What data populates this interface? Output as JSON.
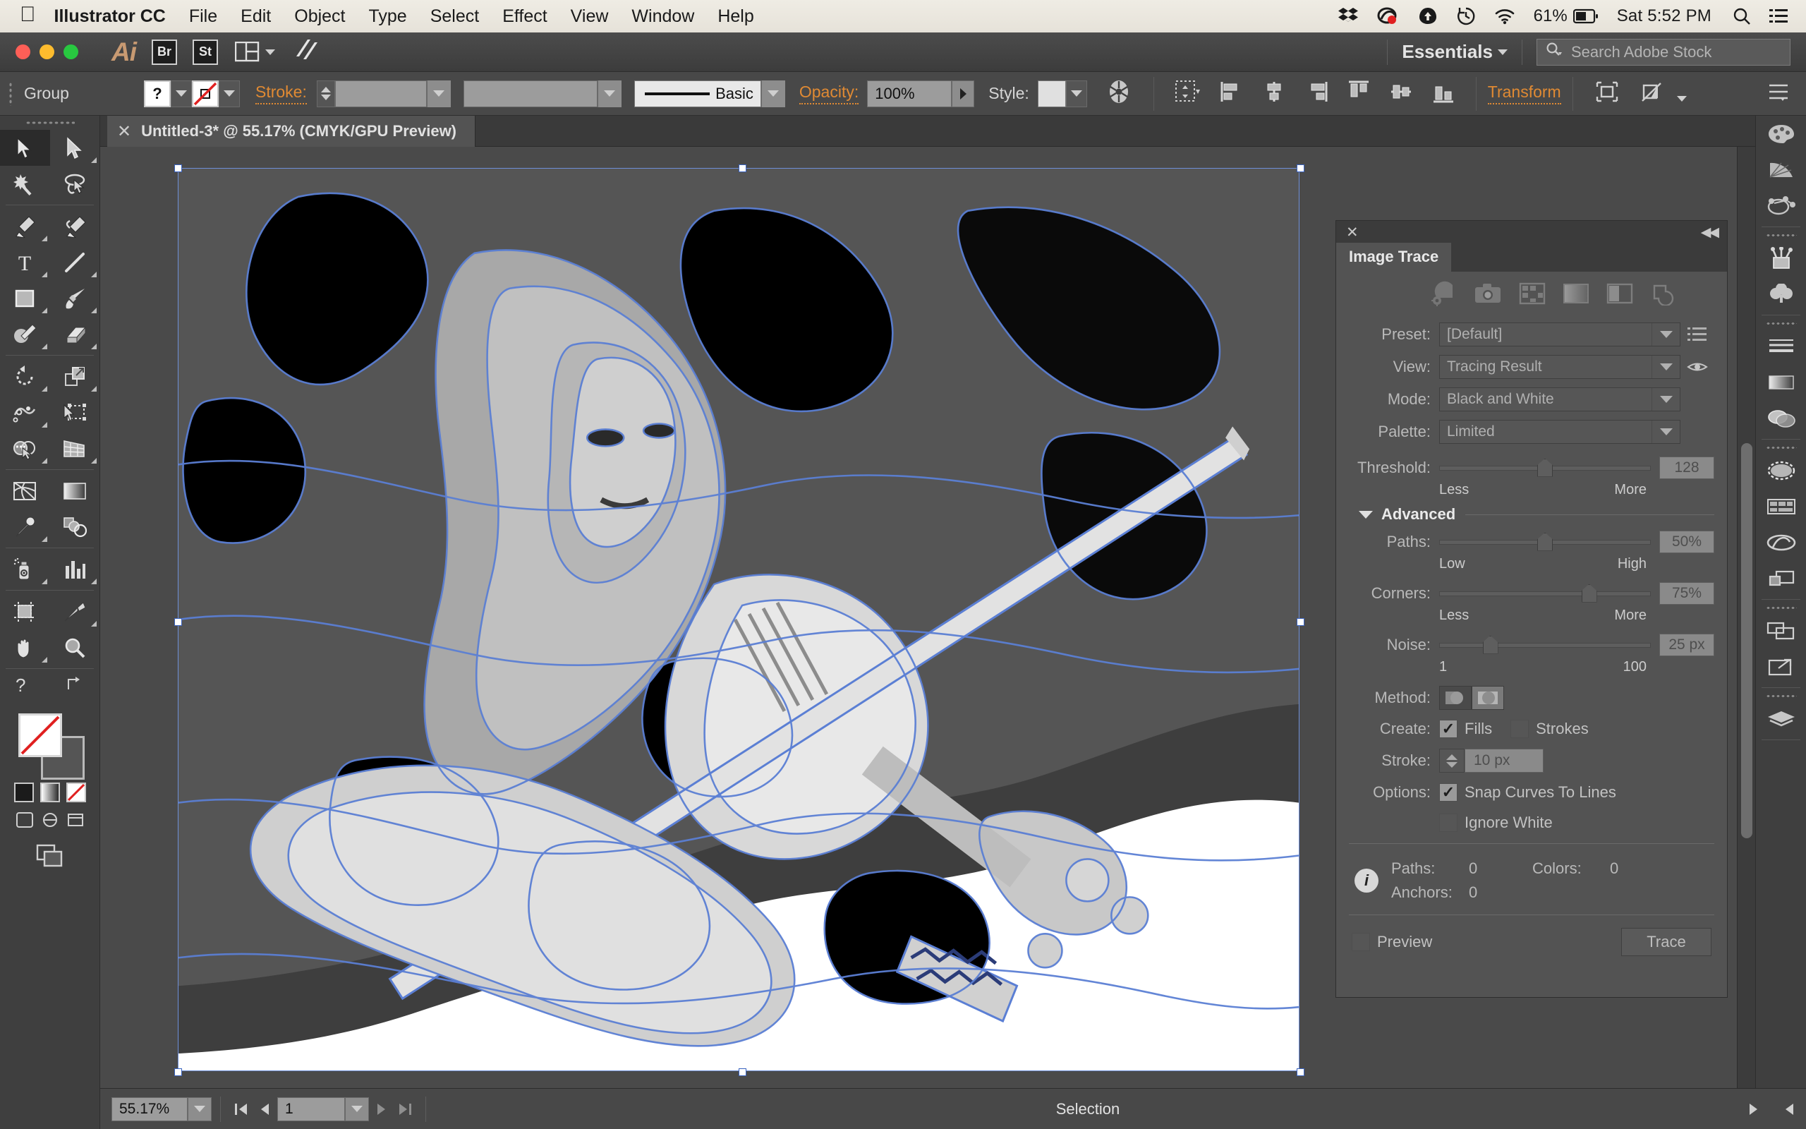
{
  "macbar": {
    "apple_icon": "apple-logo-icon",
    "menus": [
      "Illustrator CC",
      "File",
      "Edit",
      "Object",
      "Type",
      "Select",
      "Effect",
      "View",
      "Window",
      "Help"
    ],
    "status_icons": [
      "dropbox-icon",
      "creative-cloud-icon",
      "upload-icon",
      "time-machine-icon",
      "wifi-icon"
    ],
    "battery_percent": "61%",
    "clock": "Sat 5:52 PM",
    "search_icon": "spotlight-search-icon",
    "notification_icon": "notification-center-icon"
  },
  "appbar": {
    "app_icon": "Ai",
    "bridge_label": "Br",
    "stock_label": "St",
    "arrange_icon": "arrange-documents-icon",
    "behance_icon": "behance-icon",
    "workspace": "Essentials",
    "search": {
      "placeholder": "Search Adobe Stock",
      "icon": "search-icon"
    }
  },
  "controlbar": {
    "selection_label": "Group",
    "fill_label": "?",
    "stroke_label": "Stroke:",
    "stroke_weight": "",
    "profile": "",
    "brush_def": "Basic",
    "opacity_label": "Opacity:",
    "opacity_value": "100%",
    "style_label": "Style:",
    "transform_label": "Transform",
    "align_icons": [
      "align-left-icon",
      "align-center-horizontal-icon",
      "align-right-icon",
      "align-top-icon",
      "align-center-vertical-icon",
      "align-bottom-icon"
    ],
    "recolor_icon": "recolor-artwork-icon",
    "isolate_icon": "isolate-selected-object-icon",
    "mask_icon": "edit-clipping-mask-icon",
    "menu_icon": "panel-menu-icon"
  },
  "tools": {
    "groups": [
      [
        {
          "name": "selection-tool",
          "icon": "arrow-black-icon",
          "selected": true,
          "corner": false
        },
        {
          "name": "direct-selection-tool",
          "icon": "arrow-white-icon",
          "selected": false,
          "corner": true
        },
        {
          "name": "magic-wand-tool",
          "icon": "magic-wand-icon",
          "selected": false,
          "corner": false
        },
        {
          "name": "lasso-tool",
          "icon": "lasso-icon",
          "selected": false,
          "corner": false
        }
      ],
      [
        {
          "name": "pen-tool",
          "icon": "pen-icon",
          "selected": false,
          "corner": true
        },
        {
          "name": "curvature-tool",
          "icon": "curvature-icon",
          "selected": false,
          "corner": false
        },
        {
          "name": "type-tool",
          "icon": "type-T-icon",
          "selected": false,
          "corner": true
        },
        {
          "name": "line-segment-tool",
          "icon": "line-segment-icon",
          "selected": false,
          "corner": true
        },
        {
          "name": "rectangle-tool",
          "icon": "rectangle-icon",
          "selected": false,
          "corner": true
        },
        {
          "name": "paintbrush-tool",
          "icon": "paintbrush-icon",
          "selected": false,
          "corner": true
        },
        {
          "name": "shaper-tool",
          "icon": "shaper-pencil-icon",
          "selected": false,
          "corner": true
        },
        {
          "name": "eraser-tool",
          "icon": "eraser-icon",
          "selected": false,
          "corner": true
        }
      ],
      [
        {
          "name": "rotate-tool",
          "icon": "rotate-icon",
          "selected": false,
          "corner": true
        },
        {
          "name": "scale-tool",
          "icon": "scale-icon",
          "selected": false,
          "corner": true
        },
        {
          "name": "width-tool",
          "icon": "width-icon",
          "selected": false,
          "corner": true
        },
        {
          "name": "free-transform-tool",
          "icon": "free-transform-icon",
          "selected": false,
          "corner": false
        },
        {
          "name": "shape-builder-tool",
          "icon": "shape-builder-icon",
          "selected": false,
          "corner": true
        },
        {
          "name": "perspective-grid-tool",
          "icon": "perspective-grid-icon",
          "selected": false,
          "corner": true
        }
      ],
      [
        {
          "name": "mesh-tool",
          "icon": "mesh-icon",
          "selected": false,
          "corner": false
        },
        {
          "name": "gradient-tool",
          "icon": "gradient-icon",
          "selected": false,
          "corner": false
        },
        {
          "name": "eyedropper-tool",
          "icon": "eyedropper-icon",
          "selected": false,
          "corner": true
        },
        {
          "name": "blend-tool",
          "icon": "blend-icon",
          "selected": false,
          "corner": false
        }
      ],
      [
        {
          "name": "symbol-sprayer-tool",
          "icon": "symbol-sprayer-icon",
          "selected": false,
          "corner": true
        },
        {
          "name": "column-graph-tool",
          "icon": "column-graph-icon",
          "selected": false,
          "corner": true
        }
      ],
      [
        {
          "name": "artboard-tool",
          "icon": "artboard-icon",
          "selected": false,
          "corner": false
        },
        {
          "name": "slice-tool",
          "icon": "slice-icon",
          "selected": false,
          "corner": true
        },
        {
          "name": "hand-tool",
          "icon": "hand-icon",
          "selected": false,
          "corner": true
        },
        {
          "name": "zoom-tool",
          "icon": "zoom-magnifier-icon",
          "selected": false,
          "corner": false
        }
      ]
    ],
    "help_icon": "help-question-icon",
    "swap_icon": "swap-fill-stroke-icon",
    "default_icon": "default-fill-stroke-icon",
    "color_modes": [
      "color-swatch-icon",
      "gradient-swatch-icon",
      "none-swatch-icon"
    ],
    "screen_modes": [
      "normal-screen-mode-icon",
      "full-screen-menu-icon",
      "full-screen-icon"
    ],
    "draw_mode_icon": "drawing-modes-icon"
  },
  "document": {
    "tab_title": "Untitled-3* @ 55.17% (CMYK/GPU Preview)",
    "close_icon": "close-tab-icon"
  },
  "image_trace": {
    "panel_title": "Image Trace",
    "close_icon": "close-panel-icon",
    "collapse_icon": "collapse-panel-icon",
    "preset_icons": [
      "auto-color-icon",
      "high-fidelity-photo-icon",
      "low-fidelity-photo-icon",
      "grayscale-icon",
      "black-and-white-icon",
      "outline-icon"
    ],
    "preset": {
      "label": "Preset:",
      "value": "[Default]",
      "menu_icon": "preset-menu-icon"
    },
    "view": {
      "label": "View:",
      "value": "Tracing Result",
      "eye_icon": "eye-preview-icon"
    },
    "mode": {
      "label": "Mode:",
      "value": "Black and White"
    },
    "palette": {
      "label": "Palette:",
      "value": "Limited"
    },
    "threshold": {
      "label": "Threshold:",
      "value": "128",
      "min_label": "Less",
      "max_label": "More",
      "position_pct": 50
    },
    "advanced": {
      "label": "Advanced",
      "paths": {
        "label": "Paths:",
        "value": "50%",
        "min_label": "Low",
        "max_label": "High",
        "position_pct": 50
      },
      "corners": {
        "label": "Corners:",
        "value": "75%",
        "min_label": "Less",
        "max_label": "More",
        "position_pct": 71
      },
      "noise": {
        "label": "Noise:",
        "value": "25 px",
        "min_label": "1",
        "max_label": "100",
        "position_pct": 24
      },
      "method": {
        "label": "Method:",
        "options": [
          "abutting-method-icon",
          "overlapping-method-icon"
        ],
        "selected_index": 1
      },
      "create": {
        "label": "Create:",
        "fills_label": "Fills",
        "fills_checked": true,
        "strokes_label": "Strokes",
        "strokes_checked": false
      },
      "stroke": {
        "label": "Stroke:",
        "value": "10 px"
      },
      "options": {
        "label": "Options:",
        "snap_label": "Snap Curves To Lines",
        "snap_checked": true,
        "ignore_label": "Ignore White",
        "ignore_checked": false
      }
    },
    "info": {
      "icon": "info-icon",
      "paths_label": "Paths:",
      "paths_value": "0",
      "colors_label": "Colors:",
      "colors_value": "0",
      "anchors_label": "Anchors:",
      "anchors_value": "0"
    },
    "preview": {
      "label": "Preview",
      "checked": false
    },
    "trace_button": "Trace"
  },
  "right_dock": {
    "groups": [
      [
        "color-panel-icon",
        "color-guide-icon",
        "kuler-icon"
      ],
      [
        "brushes-panel-icon",
        "symbols-panel-icon"
      ],
      [
        "stroke-panel-icon",
        "gradient-panel-icon",
        "transparency-panel-icon"
      ],
      [
        "appearance-panel-icon",
        "image-trace-panel-icon",
        "creative-cloud-libraries-icon",
        "align-panel-icon"
      ],
      [
        "pathfinder-panel-icon",
        "transform-panel-icon"
      ],
      [
        "layers-panel-icon"
      ]
    ]
  },
  "statusbar": {
    "zoom": "55.17%",
    "page": "1",
    "status_text": "Selection",
    "first_icon": "first-artboard-icon",
    "prev_icon": "previous-artboard-icon",
    "next_icon": "next-artboard-icon",
    "last_icon": "last-artboard-icon",
    "status_menu_icon": "status-menu-icon"
  },
  "colors": {
    "accent_orange": "#e08a33",
    "panel_bg": "#535353",
    "toolbar_bg": "#3f3f3f",
    "trace_path_blue": "#5b7fd4"
  }
}
